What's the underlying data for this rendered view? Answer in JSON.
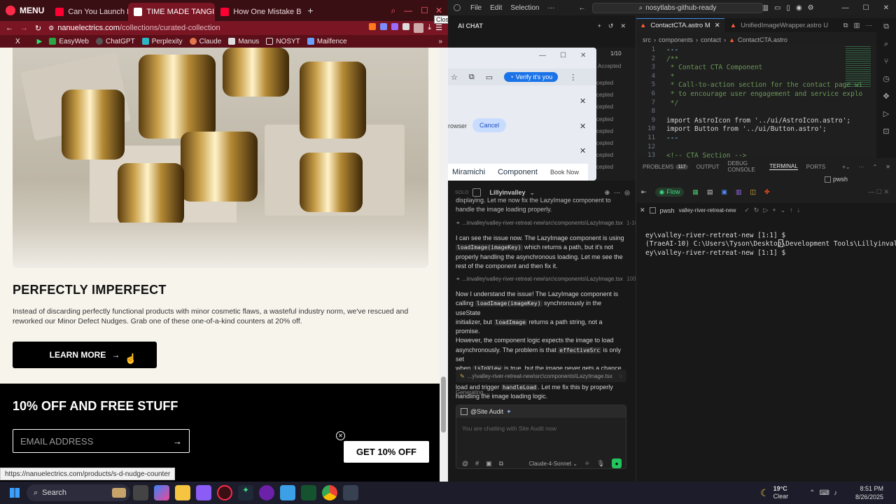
{
  "browser": {
    "menu_label": "MENU",
    "tabs": [
      {
        "label": "Can You Launch Hard",
        "color": "#ff0033"
      },
      {
        "label": "TIME MADE TANGIBLE – I",
        "color": "#c4142a"
      },
      {
        "label": "How One Mistake Broke C",
        "color": "#ff0033"
      }
    ],
    "close_tooltip": "Close",
    "url_host": "nanuelectrics.com",
    "url_path": "/collections/curated-collection",
    "bookmarks": [
      "EasyWeb",
      "ChatGPT",
      "Perplexity",
      "Claude",
      "Manus",
      "NOSYT",
      "Mailfence"
    ],
    "page": {
      "heading": "PERFECTLY IMPERFECT",
      "body": "Instead of discarding perfectly functional products with minor cosmetic flaws, a wasteful industry norm, we've rescued and reworked our Minor Defect Nudges. Grab one of these one-of-a-kind counters at 20% off.",
      "learn_more": "LEARN MORE",
      "footer_heading": "10% OFF AND FREE STUFF",
      "email_placeholder": "EMAIL ADDRESS",
      "cta": "GET 10% OFF"
    },
    "status_url": "https://nanuelectrics.com/products/s-d-nudge-counter"
  },
  "vscode": {
    "menu": [
      "File",
      "Edit",
      "Selection"
    ],
    "search": "nosytlabs-github-ready",
    "ai_chat_label": "AI CHAT",
    "editor_tabs": [
      "ContactCTA.astro M",
      "UnifiedImageWrapper.astro U"
    ],
    "breadcrumb": [
      "src",
      "components",
      "contact",
      "ContactCTA.astro"
    ],
    "code_lines": [
      {
        "n": "1",
        "t": "---",
        "c": "#9cdcfe"
      },
      {
        "n": "2",
        "t": "/**",
        "c": "#6a9955"
      },
      {
        "n": "3",
        "t": " * Contact CTA Component",
        "c": "#6a9955"
      },
      {
        "n": "4",
        "t": " *",
        "c": "#6a9955"
      },
      {
        "n": "5",
        "t": " * Call-to-action section for the contact page wi",
        "c": "#6a9955"
      },
      {
        "n": "6",
        "t": " * to encourage user engagement and service explo",
        "c": "#6a9955"
      },
      {
        "n": "7",
        "t": " */",
        "c": "#6a9955"
      },
      {
        "n": "8",
        "t": "",
        "c": "#ccc"
      },
      {
        "n": "9",
        "t": "import AstroIcon from '../ui/AstroIcon.astro';",
        "c": "#d4d4d4"
      },
      {
        "n": "10",
        "t": "import Button from '../ui/Button.astro';",
        "c": "#d4d4d4"
      },
      {
        "n": "11",
        "t": "---",
        "c": "#9cdcfe"
      },
      {
        "n": "12",
        "t": "",
        "c": "#ccc"
      },
      {
        "n": "13",
        "t": "<!-- CTA Section -->",
        "c": "#6a9955"
      }
    ],
    "panel_tabs": [
      "PROBLEMS",
      "OUTPUT",
      "DEBUG CONSOLE",
      "TERMINAL",
      "PORTS"
    ],
    "problems_count": "117",
    "terminal_name": "pwsh",
    "terminal_path": "valley-river-retreat-new",
    "terminal_lines": [
      "ey\\valley-river-retreat-new [1:1] $",
      "(TraeAI-10) C:\\Users\\Tyson\\Desktop\\Development Tools\\Lillyinvall",
      "ey\\valley-river-retreat-new [1:1] $ "
    ],
    "terminal_tab_label": "pwsh"
  },
  "popup": {
    "page_count": "1/10",
    "verify": "Verify it's you",
    "cancel": "Cancel",
    "browser_word": "rowser",
    "accepted_header": "Accepted",
    "accepted_items": [
      "cepted",
      "cepted",
      "cepted",
      "cepted",
      "cepted",
      "cepted",
      "cepted",
      "cepted"
    ],
    "strip": [
      "Miramichi",
      "Component",
      "Book Now"
    ]
  },
  "chat": {
    "workspace": "Lillyinvalley",
    "solo": "SOLO",
    "flow": "Flow",
    "top_text": "displaying. Let me now fix the LazyImage component to handle the image loading properly.",
    "file1": "...invalley\\valley-river-retreat-new\\src\\components\\LazyImage.tsx",
    "file1_range": "1-100",
    "para1_a": "I can see the issue now. The LazyImage component is using ",
    "para1_code": "loadImage(imageKey)",
    "para1_b": " which returns a path, but it's not properly handling the asynchronous loading. Let me see the rest of the component and then fix it.",
    "file2": "...invalley\\valley-river-retreat-new\\src\\components\\LazyImage.tsx",
    "file2_range": "100-166",
    "para2": [
      "Now I understand the issue! The LazyImage component is",
      "calling ",
      "loadImage(imageKey)",
      " synchronously in the useState",
      "initializer, but ",
      "loadImage",
      " returns a path string, not a promise.",
      "However, the component logic expects the image to load",
      "asynchronously. The problem is that ",
      "effectiveSrc",
      " is only set",
      "when ",
      "isInView",
      " is true, but the image never gets a chance to",
      "load and trigger ",
      "handleLoad",
      ". Let me fix this by properly",
      "handling the image loading logic."
    ],
    "editing_file": "...y\\valley-river-retreat-new\\src\\components\\LazyImage.tsx",
    "generating": "Generating ...",
    "agent": "@Site Audit",
    "input_placeholder": "You are chatting with Site Audit now",
    "model": "Claude-4-Sonnet"
  },
  "taskbar": {
    "search": "Search",
    "temp": "19°C",
    "weather": "Clear",
    "time": "8:51 PM",
    "date": "8/26/2025"
  }
}
